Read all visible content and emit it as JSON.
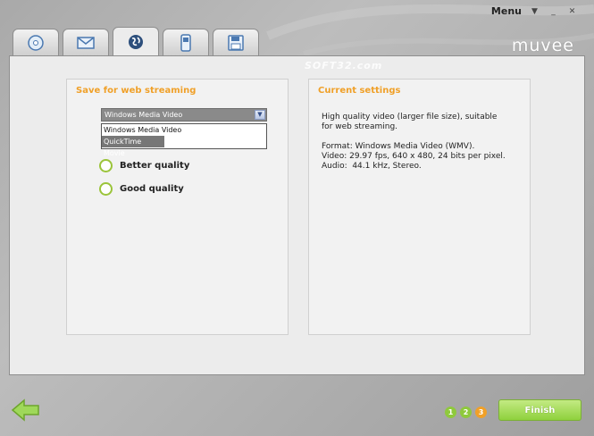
{
  "window": {
    "menu_label": "Menu",
    "logo": "muvee",
    "watermark": "SOFT32.com"
  },
  "tabs": [
    {
      "name": "disc",
      "icon": "disc-icon"
    },
    {
      "name": "email",
      "icon": "envelope-icon"
    },
    {
      "name": "web",
      "icon": "globe-icon",
      "active": true
    },
    {
      "name": "mobile",
      "icon": "phone-icon"
    },
    {
      "name": "save",
      "icon": "floppy-disk-icon"
    }
  ],
  "web_streaming": {
    "title": "Save for web streaming",
    "format_select": {
      "value": "Windows Media Video",
      "options": [
        "Windows Media Video",
        "QuickTime Movie"
      ],
      "highlighted": "QuickTime Movie"
    },
    "quality_options": [
      "Better quality",
      "Good quality"
    ]
  },
  "current_settings": {
    "title": "Current settings",
    "description": "High quality video (larger file size), suitable\nfor web streaming.",
    "details": "Format: Windows Media Video (WMV).\nVideo: 29.97 fps, 640 x 480, 24 bits per pixel.\nAudio:  44.1 kHz, Stereo."
  },
  "footer": {
    "steps": [
      "1",
      "2",
      "3"
    ],
    "finish_label": "Finish"
  },
  "colors": {
    "accent_orange": "#f0a028",
    "accent_green": "#8fd13d"
  }
}
